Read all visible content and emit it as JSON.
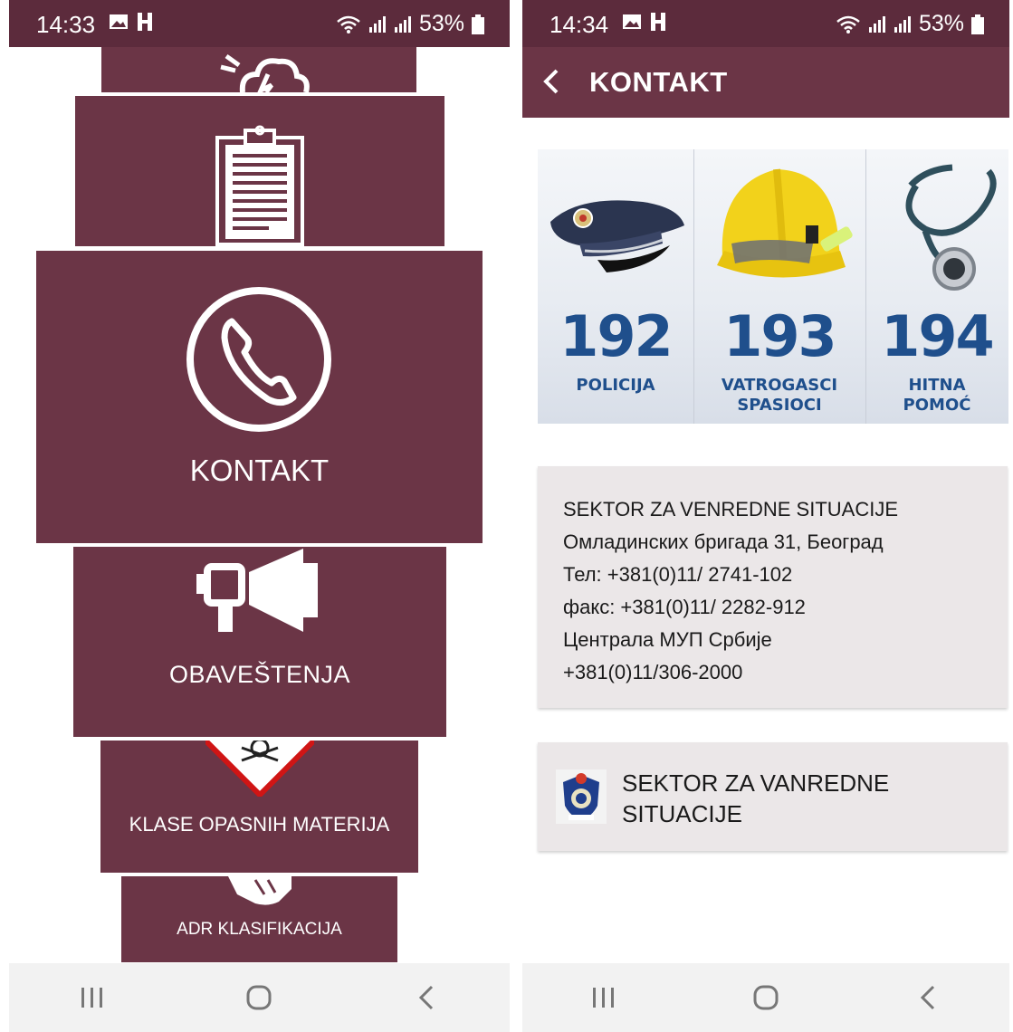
{
  "left_screen": {
    "status": {
      "time": "14:33",
      "battery": "53%"
    },
    "tiles": {
      "weather": {
        "icon": "storm-cloud-icon"
      },
      "notes": {
        "icon": "clipboard-icon"
      },
      "contact": {
        "label": "KONTAKT",
        "icon": "phone-icon"
      },
      "notices": {
        "label": "OBAVEŠTENJA",
        "icon": "megaphone-icon"
      },
      "hazard": {
        "label": "KLASE OPASNIH MATERIJA",
        "icon": "hazard-diamond-icon"
      },
      "adr": {
        "label": "ADR KLASIFIKACIJA",
        "icon": "hand-icon"
      }
    }
  },
  "right_screen": {
    "status": {
      "time": "14:34",
      "battery": "53%"
    },
    "appbar": {
      "title": "KONTAKT"
    },
    "banner": {
      "services": [
        {
          "number": "192",
          "line1": "POLICIJA",
          "line2": "",
          "icon": "police-cap-icon"
        },
        {
          "number": "193",
          "line1": "VATROGASCI",
          "line2": "SPASIOCI",
          "icon": "firefighter-helmet-icon"
        },
        {
          "number": "194",
          "line1": "HITNA",
          "line2": "POMOĆ",
          "icon": "stethoscope-icon"
        }
      ]
    },
    "info_card": {
      "lines": [
        "SEKTOR ZA VENREDNE SITUACIJE",
        "Омладинских бригада 31, Београд",
        "Тел: +381(0)11/ 2741-102",
        "факс: +381(0)11/ 2282-912",
        "Централа МУП Србије",
        "+381(0)11/306-2000"
      ]
    },
    "link_card": {
      "text": "SEKTOR ZA VANREDNE SITUACIJE",
      "icon": "sector-emblem-icon"
    }
  },
  "colors": {
    "tile": "#6b3546",
    "status_bar": "#5c2b3c",
    "number_blue": "#1f4f8c",
    "card": "#ebe7e8"
  }
}
